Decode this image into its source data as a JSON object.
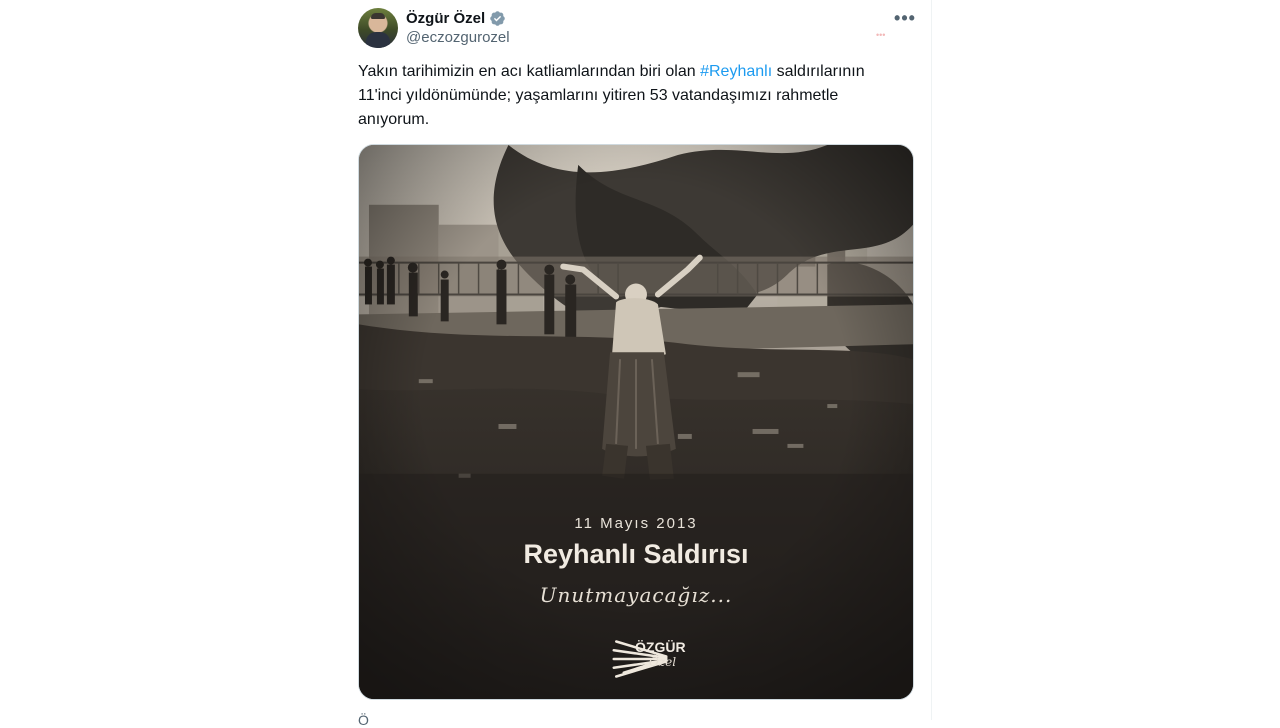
{
  "author": {
    "display_name": "Özgür Özel",
    "handle": "@eczozgurozel",
    "verified": true
  },
  "tweet": {
    "text_before": "Yakın tarihimizin en acı katliamlarından biri olan ",
    "hashtag": "#Reyhanlı",
    "text_after": " saldırılarının\n11'inci yıldönümünde; yaşamlarını yitiren 53 vatandaşımızı rahmetle\nanıyorum."
  },
  "media": {
    "date": "11 Mayıs 2013",
    "title": "Reyhanlı Saldırısı",
    "script": "Unutmayacağız...",
    "brand_name": "ÖZGÜR",
    "brand_script": "Özel"
  },
  "menu": {
    "more_label": "•••"
  },
  "colors": {
    "text": "#0f1419",
    "secondary": "#536471",
    "link": "#1d9bf0",
    "verified": "#829aab",
    "border": "#cfd9de"
  },
  "icons": {
    "verified": "verified-badge-icon",
    "more": "more-icon"
  }
}
